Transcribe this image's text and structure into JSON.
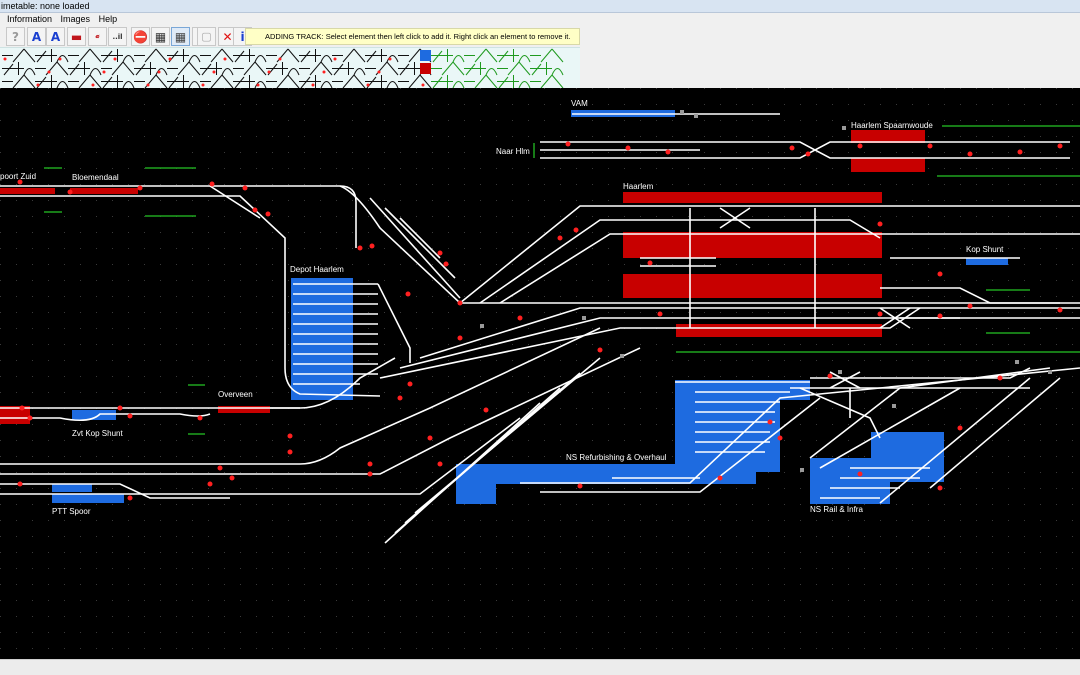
{
  "window": {
    "title": "imetable: none loaded"
  },
  "menu": {
    "items": [
      "Information",
      "Images",
      "Help"
    ]
  },
  "toolbar": {
    "buttons": [
      {
        "name": "help",
        "glyph": "?",
        "color": "#9a9a9a"
      },
      {
        "name": "text",
        "glyph": "A",
        "color": "#1a3fd0"
      },
      {
        "name": "text-size",
        "glyph": "A",
        "color": "#1a3fd0"
      },
      {
        "name": "platform",
        "glyph": "▬",
        "color": "#c0151b"
      },
      {
        "name": "script",
        "glyph": "𝒶",
        "color": "#c0151b"
      },
      {
        "name": "speed",
        "glyph": "..il",
        "color": "#333333"
      },
      {
        "name": "station",
        "glyph": "⛔",
        "color": "#7a2d20"
      },
      {
        "name": "tunnel",
        "glyph": "▦",
        "color": "#333333"
      },
      {
        "name": "grid",
        "glyph": "▦",
        "color": "#444444"
      },
      {
        "name": "signal",
        "glyph": "🚦",
        "color": "#2c7d2c"
      },
      {
        "name": "save",
        "glyph": "▢",
        "color": "#aaaaaa"
      },
      {
        "name": "delete",
        "glyph": "✕",
        "color": "#e01010"
      },
      {
        "name": "info",
        "glyph": "i",
        "color": "#1a3fd0"
      }
    ],
    "hint_text": "ADDING TRACK:  Select element then left click to add it.  Right click an element to remove it."
  },
  "layout_labels": {
    "vam": "VAM",
    "haarlem_spaarnwoude": "Haarlem Spaarnwoude",
    "naar_hlm": "Naar Hlm",
    "poort_zuid": "poort Zuid",
    "bloemendaal": "Bloemendaal",
    "haarlem": "Haarlem",
    "kop_shunt": "Kop Shunt",
    "depot_haarlem": "Depot Haarlem",
    "overveen": "Overveen",
    "zvt_kop_shunt": "Zvt Kop Shunt",
    "ns_refurbishing": "NS Refurbishing & Overhaul",
    "ptt_spoor": "PTT Spoor",
    "ns_rail_infra": "NS Rail & Infra"
  },
  "colors": {
    "track": "#ffffff",
    "platform_red": "#c80000",
    "siding_blue": "#1e6be0",
    "signal_red": "#ff2020",
    "canvas_bg": "#000000",
    "grid_dot": "#3a3a3a",
    "location_green": "#1fa41f",
    "buffer_grey": "#9a9a9a"
  }
}
